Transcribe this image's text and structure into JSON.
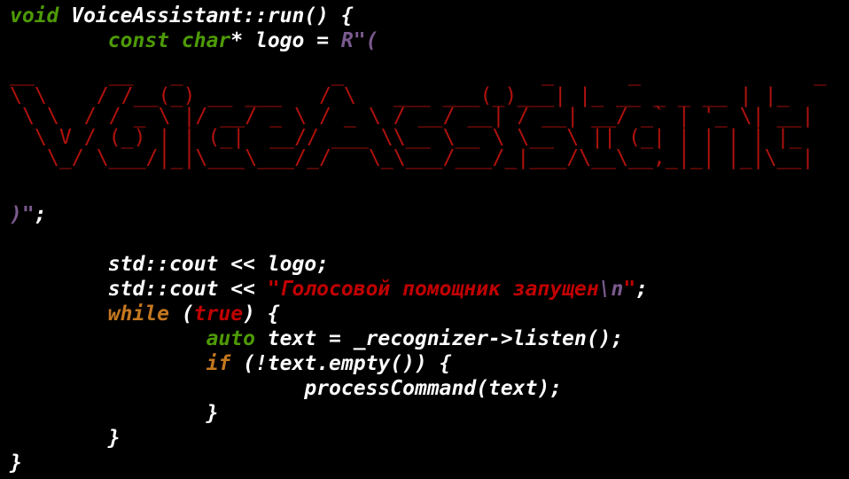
{
  "code": {
    "line1": {
      "type": "void",
      "rest": " VoiceAssistant::run() {"
    },
    "line2": {
      "indent": "        ",
      "kw1": "const",
      "sp": " ",
      "kw2": "char",
      "mid": "* logo = ",
      "raw_open": "R\"("
    },
    "banner": "__      __   _            _                _      _              _   \n\\ \\    / /__(_) __ ___   / \\   ___ ___(_)___| |_ __ _ _ __ | |_ \n \\ \\  / / _ \\ |/ __/ _ \\ / _ \\ / __/ __| / __| __/ _` | '_ \\| __|\n  \\ V / (_) | | (_|  __// ___ \\\\__ \\__ \\ \\__ \\ || (_| | | | | |_ \n   \\_/ \\___/|_|\\___\\___/_/   \\_\\___/___/_|___/\\__\\__,_|_| |_|\\__|",
    "line_close": {
      "raw_close": ")\"",
      "semi": ";"
    },
    "line3": {
      "indent": "        ",
      "text": "std::cout << logo;"
    },
    "line4": {
      "indent": "        ",
      "prefix": "std::cout << ",
      "str": "\"Голосовой помощник запущен",
      "esc": "\\n",
      "quote": "\"",
      "semi": ";"
    },
    "line5": {
      "indent": "        ",
      "kw": "while",
      "open": " (",
      "lit": "true",
      "close": ") {"
    },
    "line6": {
      "indent": "                ",
      "kw": "auto",
      "rest": " text = _recognizer->listen();"
    },
    "line7": {
      "indent": "                ",
      "kw": "if",
      "rest": " (!text.empty()) {"
    },
    "line8": {
      "indent": "                        ",
      "text": "processCommand(text);"
    },
    "line9": {
      "indent": "                ",
      "text": "}"
    },
    "line10": {
      "indent": "        ",
      "text": "}"
    },
    "line11": {
      "text": "}"
    }
  },
  "colors": {
    "background": "#000000",
    "type_keyword": "#4e9a06",
    "control_keyword": "#c4771f",
    "literal": "#c00000",
    "string": "#c00000",
    "raw_delimiter": "#7a5a8e",
    "banner": "#b0120d"
  }
}
